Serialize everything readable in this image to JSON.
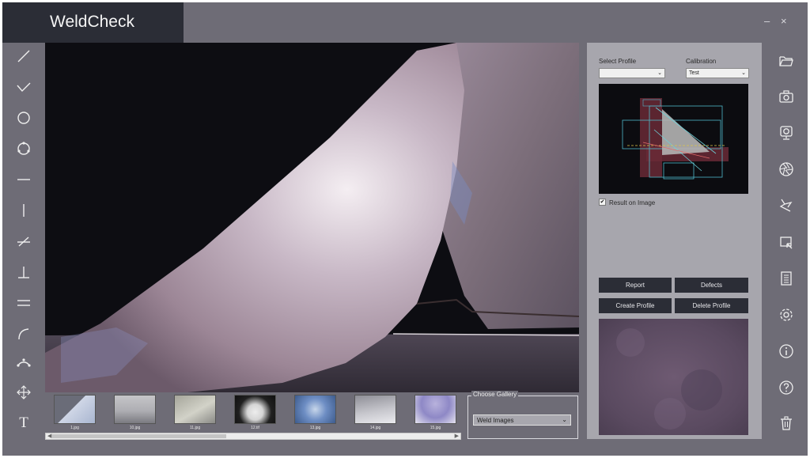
{
  "app": {
    "title": "WeldCheck",
    "minimize": "–",
    "close": "×"
  },
  "left_tools": [
    {
      "name": "line-tool-icon"
    },
    {
      "name": "polyline-tool-icon"
    },
    {
      "name": "circle-tool-icon"
    },
    {
      "name": "three-point-circle-tool-icon"
    },
    {
      "name": "horizontal-line-tool-icon"
    },
    {
      "name": "vertical-line-tool-icon"
    },
    {
      "name": "angle-tool-icon"
    },
    {
      "name": "perpendicular-tool-icon"
    },
    {
      "name": "parallel-lines-tool-icon"
    },
    {
      "name": "arc-tool-icon"
    },
    {
      "name": "three-point-arc-tool-icon"
    },
    {
      "name": "move-tool-icon"
    },
    {
      "name": "text-tool-icon",
      "glyph": "T"
    }
  ],
  "thumbnails": [
    {
      "caption": "1.jpg"
    },
    {
      "caption": "10.jpg"
    },
    {
      "caption": "11.jpg"
    },
    {
      "caption": "12.tif"
    },
    {
      "caption": "13.jpg"
    },
    {
      "caption": "14.jpg"
    },
    {
      "caption": "15.jpg"
    }
  ],
  "gallery": {
    "legend": "Choose Gallery",
    "selected": "Weld Images"
  },
  "profile_panel": {
    "select_profile_label": "Select Profile",
    "select_profile_value": "",
    "calibration_label": "Calibration",
    "calibration_value": "Test",
    "result_on_image_label": "Result on Image",
    "result_on_image_checked": "✔",
    "report_button": "Report",
    "defects_button": "Defects",
    "create_profile_button": "Create Profile",
    "delete_profile_button": "Delete Profile"
  },
  "right_tools": [
    {
      "name": "folder-open-icon"
    },
    {
      "name": "camera-icon"
    },
    {
      "name": "webcam-icon"
    },
    {
      "name": "aperture-icon"
    },
    {
      "name": "edge-detect-icon"
    },
    {
      "name": "crop-select-icon"
    },
    {
      "name": "report-document-icon"
    },
    {
      "name": "settings-gear-icon"
    },
    {
      "name": "info-icon"
    },
    {
      "name": "help-icon"
    },
    {
      "name": "delete-trash-icon"
    }
  ],
  "colors": {
    "background": "#6e6c76",
    "dark": "#2b2d36",
    "panel": "#a7a6ad"
  }
}
